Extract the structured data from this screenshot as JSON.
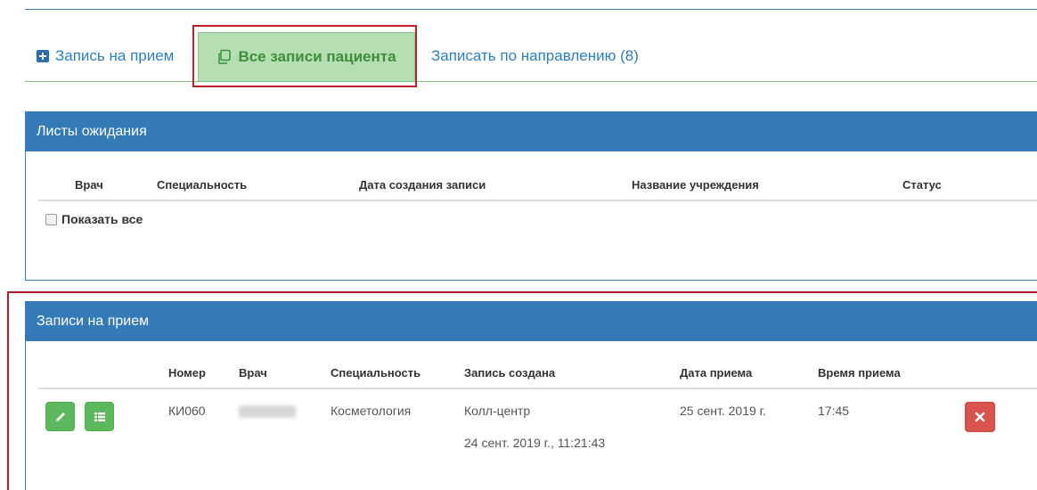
{
  "tabs": {
    "appointment": "Запись на прием",
    "all_records": "Все записи пациента",
    "referral": "Записать по направлению (8)"
  },
  "waiting_list": {
    "title": "Листы ожидания",
    "columns": [
      "Врач",
      "Специальность",
      "Дата создания записи",
      "Название учреждения",
      "Статус"
    ],
    "show_all_label": "Показать все"
  },
  "appointments": {
    "title": "Записи на прием",
    "columns": [
      "Номер",
      "Врач",
      "Специальность",
      "Запись создана",
      "Дата приема",
      "Время приема"
    ],
    "rows": [
      {
        "number": "КИ060",
        "doctor": "",
        "specialty": "Косметология",
        "created_by": "Колл-центр",
        "created_at": "24 сент. 2019 г., 11:21:43",
        "date": "25 сент. 2019 г.",
        "time": "17:45"
      }
    ]
  },
  "colors": {
    "panel_header": "#337ab7",
    "active_tab": "#b5deb3",
    "success_button": "#5cb85c",
    "danger_button": "#d9534f",
    "highlight_frame": "#c0202a"
  },
  "icons": [
    "plus-square-icon",
    "copy-icon",
    "pencil-icon",
    "list-icon",
    "close-icon"
  ]
}
